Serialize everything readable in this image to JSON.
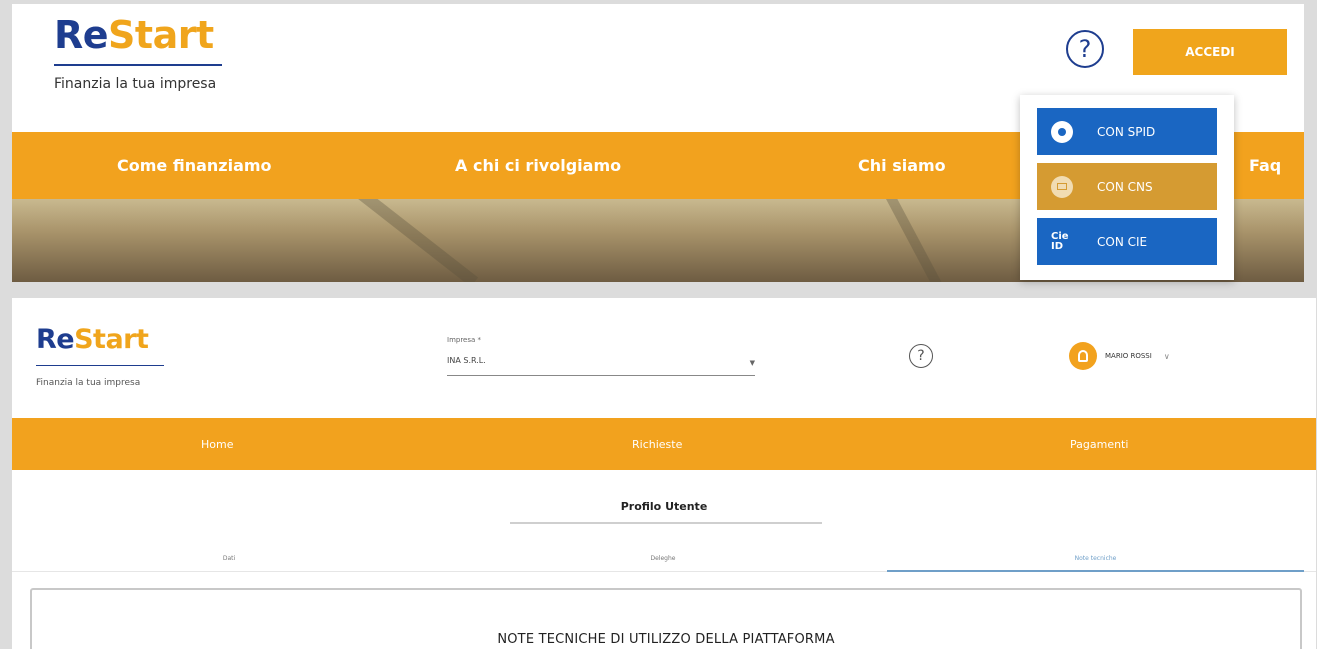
{
  "top": {
    "logo": {
      "re": "Re",
      "start": "Start",
      "tagline": "Finanzia la tua impresa"
    },
    "help_glyph": "?",
    "login_button": "ACCEDI",
    "nav": [
      "Come finanziamo",
      "A chi ci rivolgiamo",
      "Chi siamo",
      "Faq"
    ],
    "login_menu": [
      {
        "label": "CON SPID",
        "icon": "user-icon"
      },
      {
        "label": "CON CNS",
        "icon": "card-icon"
      },
      {
        "label": "CON CIE",
        "icon": "cie-id-icon",
        "icon_text": "Cie ID"
      }
    ]
  },
  "bottom": {
    "logo": {
      "re": "Re",
      "start": "Start",
      "tagline": "Finanzia la tua impresa"
    },
    "impresa": {
      "label": "Impresa *",
      "value": "INA S.R.L."
    },
    "help_glyph": "?",
    "user": {
      "name": "MARIO ROSSI"
    },
    "nav": [
      "Home",
      "Richieste",
      "Pagamenti"
    ],
    "profile_title": "Profilo Utente",
    "tabs": [
      "Dati",
      "Deleghe",
      "Note tecniche"
    ],
    "active_tab": "Note tecniche",
    "note_title": "NOTE TECNICHE DI UTILIZZO DELLA PIATTAFORMA"
  },
  "colors": {
    "brand_blue": "#1e3d8f",
    "brand_orange": "#f2a21e",
    "spid_blue": "#1a66c2",
    "cns_gold": "#d59b32"
  }
}
